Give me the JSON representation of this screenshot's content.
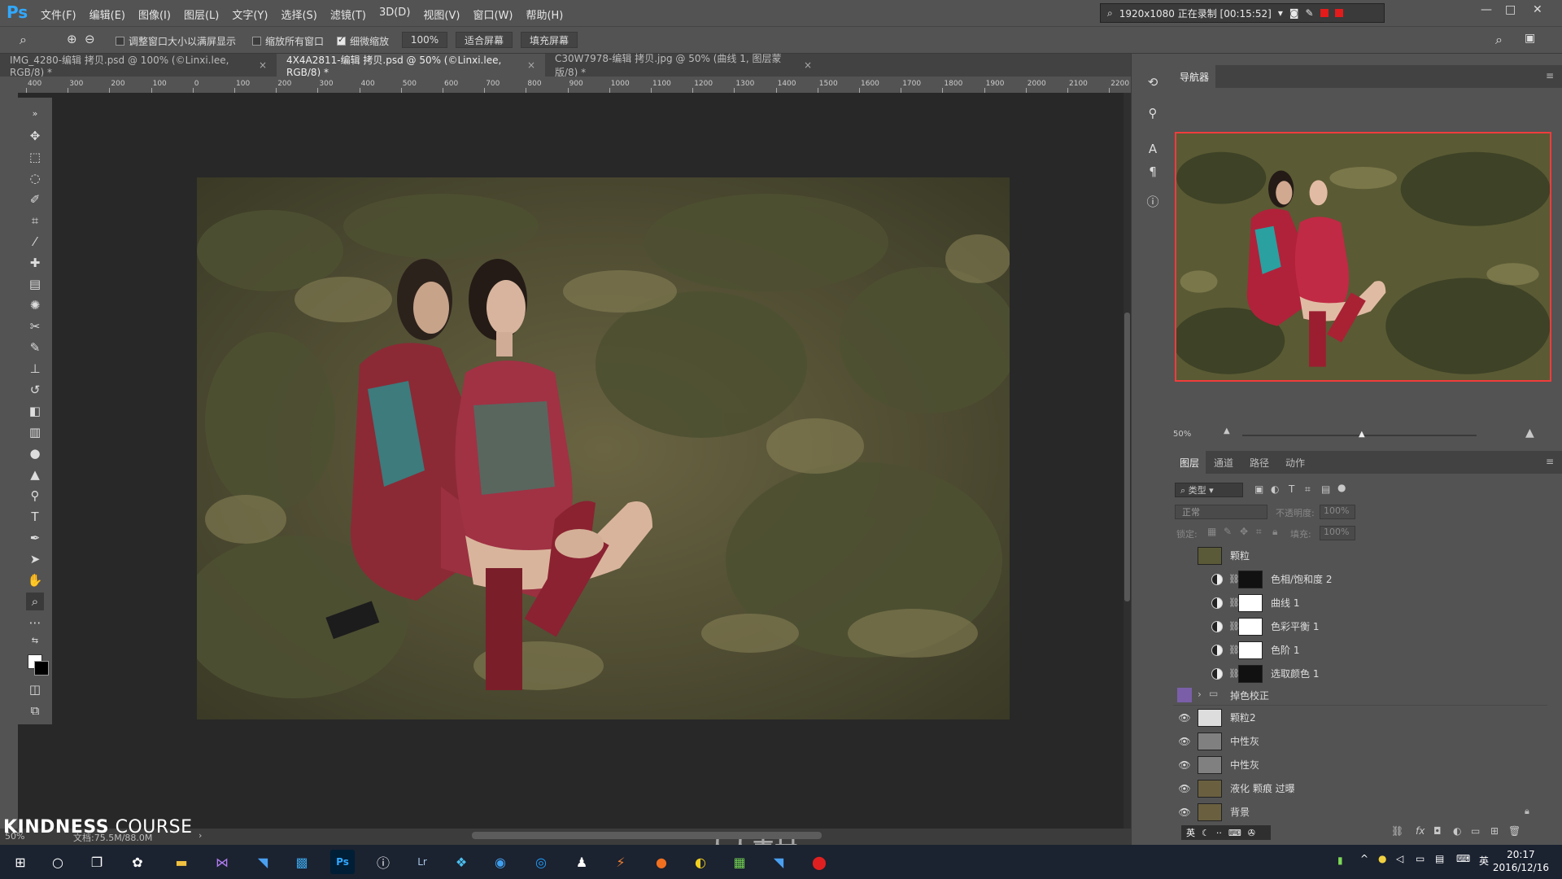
{
  "app": {
    "logo": "Ps"
  },
  "menu": [
    "文件(F)",
    "编辑(E)",
    "图像(I)",
    "图层(L)",
    "文字(Y)",
    "选择(S)",
    "滤镜(T)",
    "3D(D)",
    "视图(V)",
    "窗口(W)",
    "帮助(H)"
  ],
  "recorder": {
    "label": "1920x1080  正在录制 [00:15:52]",
    "rec_color": "#e31b1b"
  },
  "options": {
    "resize_windows": "调整窗口大小以满屏显示",
    "zoom_all": "缩放所有窗口",
    "scrubby_zoom": "细微缩放",
    "zoom_value": "100%",
    "fit_screen": "适合屏幕",
    "fill_screen": "填充屏幕"
  },
  "doc_tabs": [
    {
      "label": "IMG_4280-编辑 拷贝.psd @ 100% (©Linxi.lee, RGB/8) *",
      "close": "×"
    },
    {
      "label": "4X4A2811-编辑 拷贝.psd @ 50% (©Linxi.lee, RGB/8) *",
      "close": "×"
    },
    {
      "label": "C30W7978-编辑 拷贝.jpg @ 50% (曲线 1, 图层蒙版/8) *",
      "close": "×"
    }
  ],
  "ruler": [
    "400",
    "300",
    "200",
    "100",
    "0",
    "100",
    "200",
    "300",
    "400",
    "500",
    "600",
    "700",
    "800",
    "900",
    "1000",
    "1100",
    "1200",
    "1300",
    "1400",
    "1500",
    "1600",
    "1700",
    "1800",
    "1900",
    "2000",
    "2100",
    "2200"
  ],
  "statusbar": {
    "zoom": "50%",
    "doc": "文档:75.5M/88.0M"
  },
  "watermark": {
    "kindness": "KINDNESS",
    "course": "COURSE",
    "site": "人人素材"
  },
  "navigator": {
    "title": "导航器",
    "zoom": "50%"
  },
  "layers_panel": {
    "tabs": [
      "图层",
      "通道",
      "路径",
      "动作"
    ],
    "filter_kind": "类型",
    "blend_mode": "正常",
    "opacity_label": "不透明度:",
    "opacity_value": "100%",
    "lock_label": "锁定:",
    "fill_label": "填充:",
    "fill_value": "100%",
    "layers": [
      {
        "name": "颗粒",
        "visible": false,
        "type": "pixel"
      },
      {
        "name": "色相/饱和度 2",
        "visible": false,
        "type": "adjust",
        "mask": "dark"
      },
      {
        "name": "曲线 1",
        "visible": false,
        "type": "adjust",
        "mask": "white"
      },
      {
        "name": "色彩平衡 1",
        "visible": false,
        "type": "adjust",
        "mask": "white"
      },
      {
        "name": "色阶 1",
        "visible": false,
        "type": "adjust",
        "mask": "white"
      },
      {
        "name": "选取颜色 1",
        "visible": false,
        "type": "adjust",
        "mask": "dark"
      },
      {
        "name": "掉色校正",
        "visible": false,
        "type": "group"
      },
      {
        "name": "颗粒2",
        "visible": true,
        "type": "pixel-light"
      },
      {
        "name": "中性灰",
        "visible": true,
        "type": "gray"
      },
      {
        "name": "中性灰",
        "visible": true,
        "type": "gray"
      },
      {
        "name": "液化 颗痕 过曝",
        "visible": true,
        "type": "pixel"
      },
      {
        "name": "背景",
        "visible": true,
        "type": "pixel",
        "locked": true
      }
    ]
  },
  "ime": {
    "lang": "英"
  },
  "clock": {
    "time": "20:17",
    "date": "2016/12/16",
    "lang": "英"
  }
}
